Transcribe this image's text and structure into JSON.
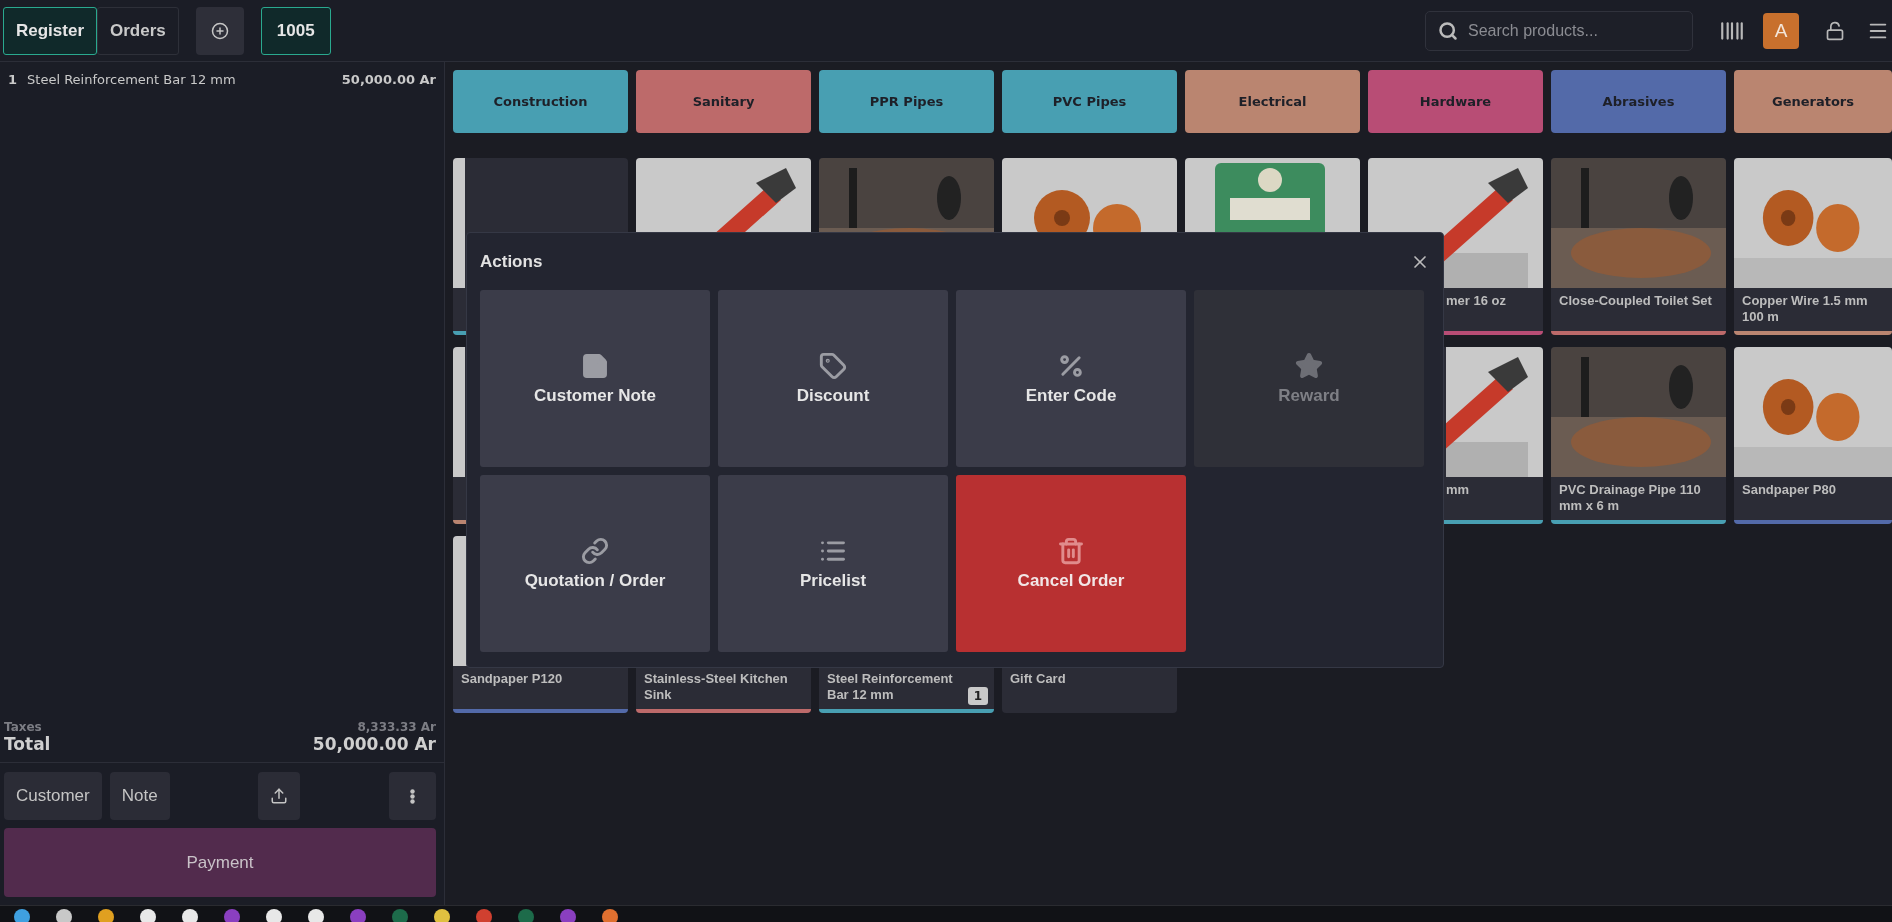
{
  "top_bar": {
    "tabs": [
      {
        "label": "Register",
        "selected": true
      },
      {
        "label": "Orders",
        "selected": false
      }
    ],
    "order_tabs": [
      {
        "label": "1005",
        "selected": true
      }
    ],
    "search": {
      "placeholder": "Search products..."
    },
    "user_initial": "A"
  },
  "order": {
    "lines": [
      {
        "quantity": "1",
        "name": "Steel Reinforcement Bar 12 mm",
        "price": "50,000.00 Ar"
      }
    ],
    "taxes_label": "Taxes",
    "taxes": "8,333.33 Ar",
    "total_label": "Total",
    "total": "50,000.00 Ar"
  },
  "order_buttons": [
    {
      "label": "Customer"
    },
    {
      "label": "Note"
    }
  ],
  "payment": "Payment",
  "categories": [
    {
      "label": "Construction",
      "color": "#489fb2"
    },
    {
      "label": "Sanitary",
      "color": "#bd6a6a"
    },
    {
      "label": "PPR Pipes",
      "color": "#489fb2"
    },
    {
      "label": "PVC Pipes",
      "color": "#489fb2"
    },
    {
      "label": "Electrical",
      "color": "#ba8570"
    },
    {
      "label": "Hardware",
      "color": "#b84d75"
    },
    {
      "label": "Abrasives",
      "color": "#536aa9"
    },
    {
      "label": "Generators",
      "color": "#ba8570"
    }
  ],
  "products": [
    {
      "kind": "edge",
      "color": "#489fb2"
    },
    {
      "kind": "covered"
    },
    {
      "kind": "covered"
    },
    {
      "kind": "covered"
    },
    {
      "kind": "covered"
    },
    {
      "kind": "under",
      "name": "mer 16 oz",
      "color": "#b84d75"
    },
    {
      "kind": "card",
      "name": "Close-Coupled Toilet Set",
      "color": "#bd6a6a"
    },
    {
      "kind": "card",
      "name": "Copper Wire 1.5 mm 100 m",
      "color": "#ba8570"
    },
    {
      "kind": "edge",
      "color": "#ba8570"
    },
    {
      "kind": "side",
      "name": "mm",
      "color": "#489fb2"
    },
    {
      "kind": "card",
      "name": "PVC Drainage Pipe 110 mm x 6 m",
      "color": "#489fb2"
    },
    {
      "kind": "card",
      "name": "Sandpaper P80",
      "color": "#536aa9"
    },
    {
      "kind": "card",
      "name": "Sandpaper P120",
      "color": "#536aa9"
    },
    {
      "kind": "card",
      "name": "Stainless-Steel Kitchen Sink",
      "color": "#bd6a6a"
    },
    {
      "kind": "card",
      "name": "Steel Reinforcement Bar 12 mm",
      "color": "#489fb2",
      "quantity": "1"
    },
    {
      "kind": "card",
      "name": "Gift Card"
    }
  ],
  "actions_dialog": {
    "title": "Actions",
    "actions": [
      {
        "label": "Customer Note",
        "kind": "normal",
        "disabled": false
      },
      {
        "label": "Discount",
        "kind": "normal",
        "disabled": false
      },
      {
        "label": "Enter Code",
        "kind": "normal",
        "disabled": false
      },
      {
        "label": "Reward",
        "kind": "normal",
        "disabled": true
      },
      {
        "label": "Quotation / Order",
        "kind": "normal",
        "disabled": false
      },
      {
        "label": "Pricelist",
        "kind": "normal",
        "disabled": false
      },
      {
        "label": "Cancel Order",
        "kind": "danger",
        "disabled": false
      }
    ]
  }
}
